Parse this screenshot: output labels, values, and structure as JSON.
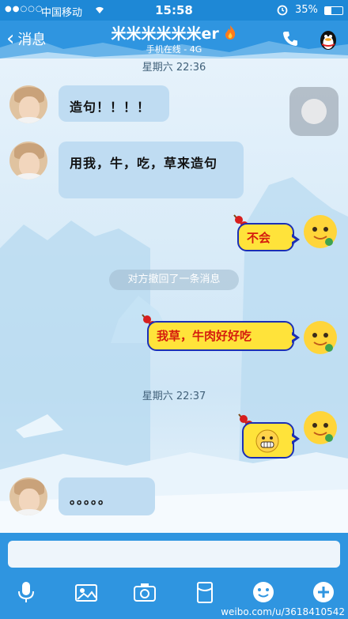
{
  "status_bar": {
    "carrier": "中国移动",
    "time": "15:58",
    "battery": "35%",
    "battery_level": 0.35,
    "icons": [
      "signal-dots-icon",
      "wifi-icon",
      "alarm-icon",
      "battery-icon"
    ]
  },
  "nav": {
    "back_label": "消息",
    "title": "米米米米米米er",
    "subtitle": "手机在线 - 4G",
    "icons": [
      "back-chevron-icon",
      "flame-icon",
      "phone-icon",
      "penguin-icon"
    ]
  },
  "messages": [
    {
      "kind": "time",
      "text": "星期六 22:36"
    },
    {
      "kind": "incoming",
      "text": "造句！！！！"
    },
    {
      "kind": "incoming",
      "text": "用我，牛，吃，草来造句"
    },
    {
      "kind": "outgoing",
      "text": "不会"
    },
    {
      "kind": "system",
      "text": "对方撤回了一条消息"
    },
    {
      "kind": "outgoing",
      "text": "我草，牛肉好好吃"
    },
    {
      "kind": "time",
      "text": "星期六 22:37"
    },
    {
      "kind": "outgoing-emoji",
      "icon": "grinning-emoji-icon"
    },
    {
      "kind": "incoming",
      "text": "。。。。。"
    }
  ],
  "toolbar": {
    "icons": [
      "microphone-icon",
      "photo-icon",
      "camera-icon",
      "red-packet-icon",
      "emoji-icon",
      "plus-icon"
    ]
  },
  "watermark": "weibo.com/u/3618410542",
  "colors": {
    "nav_blue": "#2f95e0",
    "incoming_bubble": "#bfdcf2",
    "outgoing_bubble": "#ffe33a",
    "outgoing_text": "#d51c0e"
  }
}
